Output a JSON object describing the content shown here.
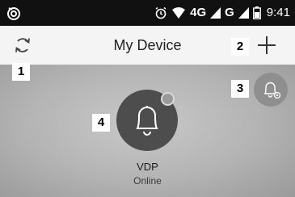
{
  "status_bar": {
    "network_label": "4G",
    "network_label_2": "G",
    "time": "9:41",
    "icons": [
      "notification-app-icon",
      "alarm-icon",
      "wifi-signal-icon",
      "cell-signal-icon",
      "battery-icon"
    ]
  },
  "header": {
    "title": "My Device",
    "refresh_icon": "refresh-icon",
    "add_icon": "plus-icon"
  },
  "callouts": {
    "one": "1",
    "two": "2",
    "three": "3",
    "four": "4"
  },
  "device": {
    "name": "VDP",
    "status": "Online",
    "icon": "bell-icon",
    "settings_icon": "bell-settings-icon"
  },
  "colors": {
    "status_bar_bg": "#111111",
    "header_bg": "#f4f4f4",
    "device_button_bg": "#4d4d4d",
    "settings_button_bg": "#8f8f8f"
  }
}
